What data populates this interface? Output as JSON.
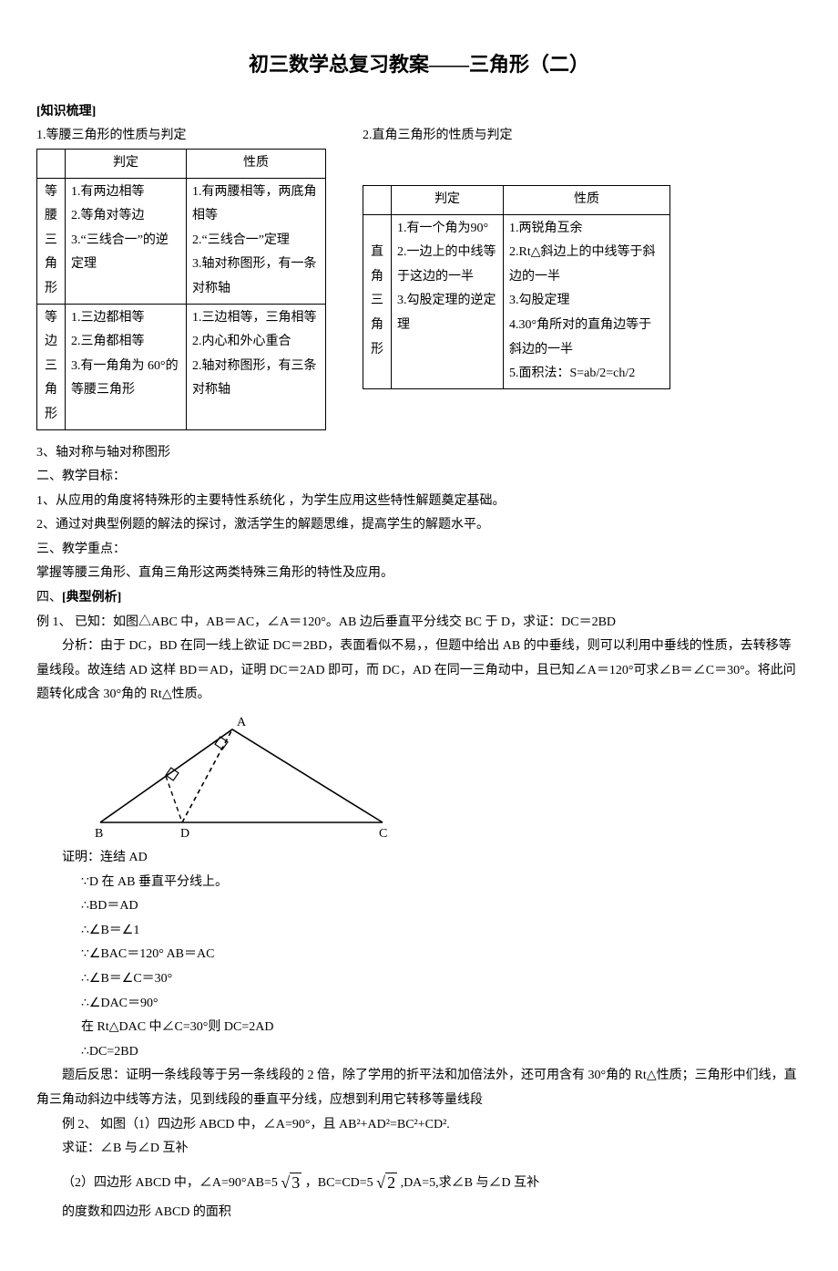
{
  "title": "初三数学总复习教案——三角形（二）",
  "section_knowledge": "[知识梳理]",
  "line1_left": "1.等腰三角形的性质与判定",
  "line1_right": "2.直角三角形的性质与判定",
  "tableA": {
    "h_blank": "",
    "h_judge": "判定",
    "h_prop": "性质",
    "row1_label": "等腰三角形",
    "row1_judge": "1.有两边相等\n2.等角对等边\n3.“三线合一”的逆定理",
    "row1_prop": "1.有两腰相等，两底角相等\n2.“三线合一”定理\n3.轴对称图形，有一条对称轴",
    "row2_label": "等边三角形",
    "row2_judge": "1.三边都相等\n2.三角都相等\n3.有一角角为 60°的等腰三角形",
    "row2_prop": "1.三边相等，三角相等\n2.内心和外心重合\n2.轴对称图形，有三条对称轴"
  },
  "tableB": {
    "h_blank": "",
    "h_judge": "判定",
    "h_prop": "性质",
    "row1_label": "直角三角形",
    "row1_judge": "1.有一个角为90°\n2.一边上的中线等于这边的一半\n3.勾股定理的逆定理",
    "row1_prop": "1.两锐角互余\n2.Rt△斜边上的中线等于斜边的一半\n3.勾股定理\n4.30°角所对的直角边等于斜边的一半\n5.面积法：S=ab/2=ch/2"
  },
  "sec3": "3、轴对称与轴对称图形",
  "sec_goal_h": "二、教学目标：",
  "sec_goal_1": "1、从应用的角度将特殊形的主要特性系统化 ，为学生应用这些特性解题奠定基础。",
  "sec_goal_2": "2、通过对典型例题的解法的探讨，激活学生的解题思维，提高学生的解题水平。",
  "sec_keypoint_h": "三、教学重点：",
  "sec_keypoint_1": "掌握等腰三角形、直角三角形这两类特殊三角形的特性及应用。",
  "sec4_h": "四、[典型例析]",
  "ex1_line1": "例 1、   已知：如图△ABC 中，AB＝AC，∠A＝120°。AB 边后垂直平分线交 BC 于 D，求证：DC＝2BD",
  "ex1_analysis1": "分析：由于 DC，BD 在同一线上欲证 DC＝2BD，表面看似不易，，但题中给出 AB 的中垂线，则可以利用中垂线的性质，去转移等量线段。故连结 AD 这样 BD＝AD，证明 DC＝2AD 即可，而 DC，AD 在同一三角动中，且已知∠A＝120°可求∠B＝∠C＝30°。将此问题转化成含 30°角的 Rt△性质。",
  "svg_labels": {
    "A": "A",
    "B": "B",
    "C": "C",
    "D": "D"
  },
  "proof_head": "证明：连结 AD",
  "proof_1": "∵D 在 AB  垂直平分线上。",
  "proof_2": "∴BD＝AD",
  "proof_3": "∴∠B＝∠1",
  "proof_4": "∵∠BAC＝120°    AB＝AC",
  "proof_5": "∴∠B＝∠C＝30°",
  "proof_6": "∴∠DAC＝90°",
  "proof_7": "在 Rt△DAC 中∠C=30°则  DC=2AD",
  "proof_8": "∴DC=2BD",
  "reflect": "题后反思：证明一条线段等于另一条线段的 2 倍，除了学用的折平法和加倍法外，还可用含有 30°角的 Rt△性质；三角形中们线，直角三角动斜边中线等方法，见到线段的垂直平分线，应想到利用它转移等量线段",
  "ex2_line1": "例 2、  如图（1）四边形 ABCD 中，∠A=90°，且 AB²+AD²=BC²+CD².",
  "ex2_line2": "求证：∠B 与∠D 互补",
  "ex2_line3a": "（2）四边形 ABCD 中，∠A=90°AB=5",
  "ex2_line3b": "，BC=CD=5",
  "ex2_line3c": " ,DA=5,求∠B 与∠D 互补",
  "sqrt3": "3",
  "sqrt2": "2",
  "ex2_line4": "的度数和四边形 ABCD 的面积"
}
